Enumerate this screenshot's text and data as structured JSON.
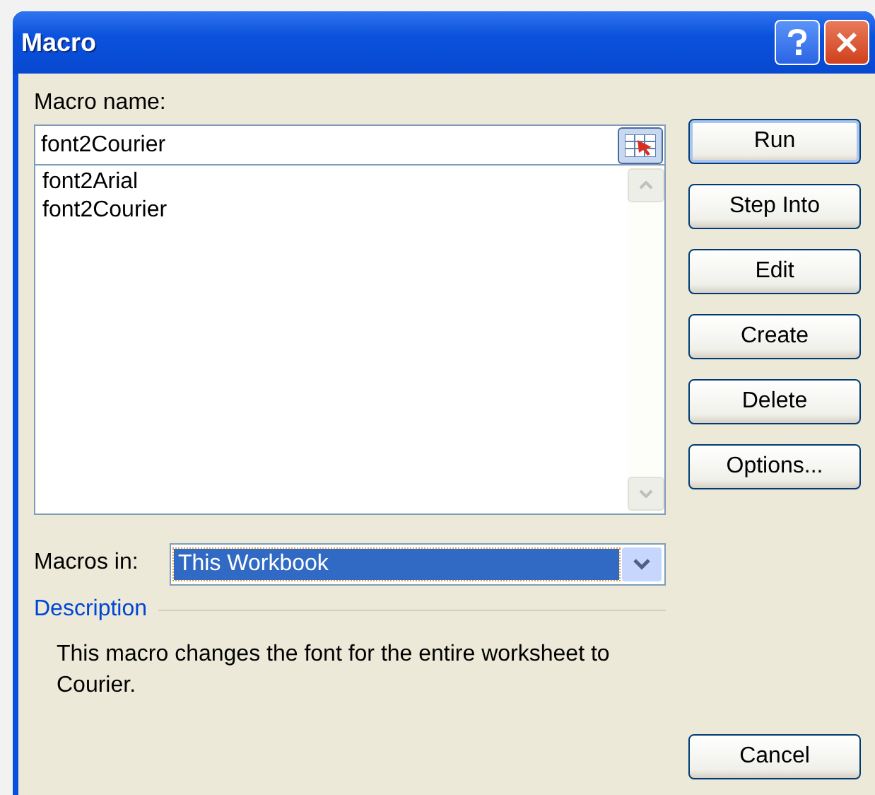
{
  "window": {
    "title": "Macro"
  },
  "macro_name": {
    "label": "Macro name:",
    "value": "font2Courier"
  },
  "macro_list": [
    {
      "name": "font2Arial",
      "selected": false
    },
    {
      "name": "font2Courier",
      "selected": false
    }
  ],
  "buttons": [
    {
      "label": "Run",
      "default": true
    },
    {
      "label": "Step Into",
      "default": false
    },
    {
      "label": "Edit",
      "default": false
    },
    {
      "label": "Create",
      "default": false
    },
    {
      "label": "Delete",
      "default": false
    },
    {
      "label": "Options...",
      "default": false
    }
  ],
  "macros_in": {
    "label": "Macros in:",
    "value": "This Workbook"
  },
  "description": {
    "heading": "Description",
    "text": "This macro changes the font for the entire worksheet to Courier."
  },
  "cancel_button": {
    "label": "Cancel"
  }
}
